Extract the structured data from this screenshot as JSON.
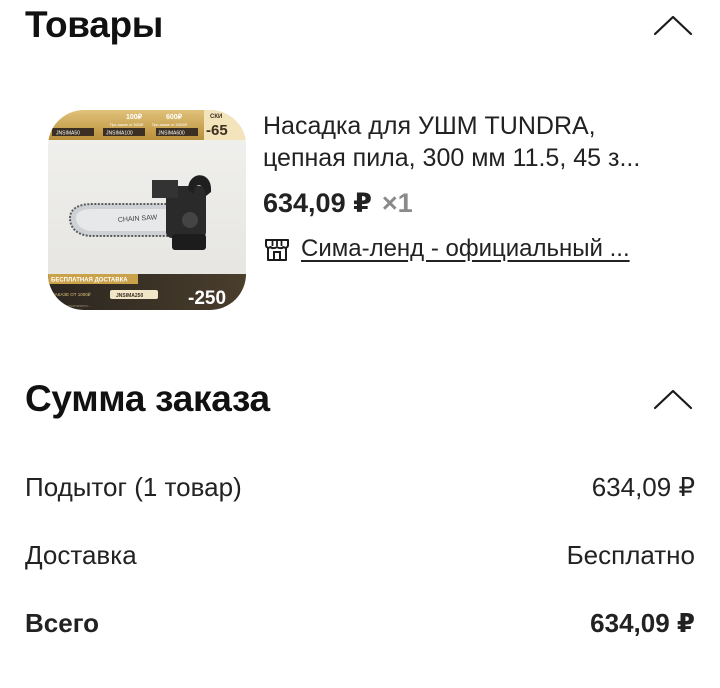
{
  "goods": {
    "title": "Товары"
  },
  "product": {
    "name_line1": "Насадка для УШМ TUNDRA,",
    "name_line2": "цепная пила, 300 мм 11.5, 45 з...",
    "price": "634,09 ₽",
    "quantity": "×1",
    "seller": "Сима-ленд - официальный ...",
    "image": {
      "promo_top": [
        "100₽",
        "600₽"
      ],
      "promo_top_sub": [
        "При заказе от 3000₽",
        "При заказе от 10000₽"
      ],
      "codes_top": [
        "JNSIMA50",
        "JNSIMA100",
        "JNSIMA600"
      ],
      "promo_right_top": "СКИ",
      "promo_right_value": "-65",
      "chainsaw_text": "CHAIN SAW",
      "free_delivery": "БЕСПЛАТНАЯ ДОСТАВКА",
      "order_from": "ЗАКАЗЕ ОТ 1000₽",
      "code_bottom": "JNSIMA250",
      "promo_bottom": "-250",
      "footer_text": "...заказ ограничено..."
    }
  },
  "summary": {
    "title": "Сумма заказа",
    "subtotal_label": "Подытог (1 товар)",
    "subtotal_value": "634,09 ₽",
    "delivery_label": "Доставка",
    "delivery_value": "Бесплатно",
    "total_label": "Всего",
    "total_value": "634,09 ₽"
  },
  "colors": {
    "text": "#222222",
    "muted": "#8a8a8a",
    "banner_gold": "#c9a24a",
    "banner_dark": "#2b2620"
  },
  "icons": {
    "collapse": "chevron-up-icon",
    "shop": "shop-icon"
  }
}
